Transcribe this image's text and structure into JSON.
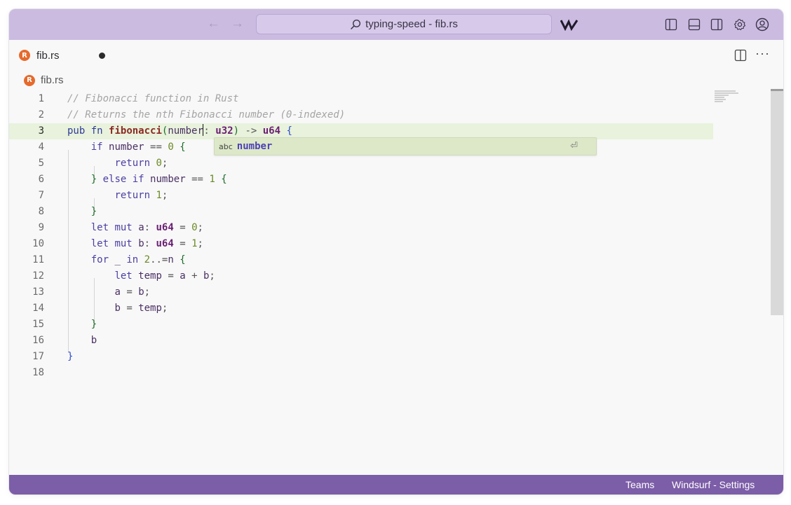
{
  "titlebar": {
    "back_arrow": "←",
    "forward_arrow": "→",
    "search_text": "typing-speed - fib.rs",
    "icons": [
      "search-icon",
      "windsurf-logo-icon",
      "toggle-primary-sidebar-icon",
      "toggle-panel-icon",
      "toggle-secondary-sidebar-icon",
      "settings-gear-icon",
      "account-icon"
    ]
  },
  "tabs": [
    {
      "label": "fib.rs",
      "icon": "rust-file-icon",
      "modified": true
    }
  ],
  "editor_actions": {
    "more": "···",
    "icons": [
      "split-editor-icon",
      "more-actions-icon"
    ]
  },
  "breadcrumb": {
    "file": "fib.rs"
  },
  "editor": {
    "line_numbers": [
      "1",
      "2",
      "3",
      "4",
      "5",
      "6",
      "7",
      "8",
      "9",
      "10",
      "11",
      "12",
      "13",
      "14",
      "15",
      "16",
      "17",
      "18"
    ],
    "current_line": 3
  },
  "suggestion": {
    "kind": "abc",
    "label": "number",
    "accept_glyph": "⏎"
  },
  "statusbar": {
    "teams": "Teams",
    "settings": "Windsurf - Settings"
  },
  "colors": {
    "titlebar": "#cbbbe1",
    "statusbar": "#7c5da7",
    "active_line": "#e8f2dc",
    "suggest_bg": "#dde8c9",
    "rust_icon": "#e66a2c"
  }
}
